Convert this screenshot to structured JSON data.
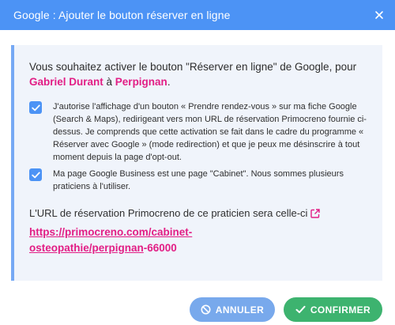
{
  "dialog": {
    "title": "Google : Ajouter le bouton réserver en ligne",
    "close_icon": "close-icon"
  },
  "intro": {
    "line1": "Vous souhaitez activer le bouton \"Réserver en ligne\" de Google, pour",
    "practitioner": "Gabriel Durant",
    "a_word": " à ",
    "city": "Perpignan",
    "end": "."
  },
  "checkboxes": [
    {
      "checked": true,
      "text": "J'autorise l'affichage d'un bouton « Prendre rendez-vous » sur ma fiche Google (Search & Maps), redirigeant vers mon URL de réservation Primocreno fournie ci-dessus. Je comprends que cette activation se fait dans le cadre du programme « Réserver avec Google » (mode redirection) et que je peux me désinscrire à tout moment depuis la page d'opt-out."
    },
    {
      "checked": true,
      "text": "Ma page Google Business est une page \"Cabinet\". Nous sommes plusieurs praticiens à l'utiliser."
    }
  ],
  "url_section": {
    "label": "L'URL de réservation Primocreno de ce praticien sera celle-ci",
    "link_text": "https://primocreno.com/cabinet-osteopathie/perpignan",
    "suffix": "-66000"
  },
  "buttons": {
    "cancel": "ANNULER",
    "confirm": "CONFIRMER"
  },
  "colors": {
    "header": "#4c93f5",
    "accent_pink": "#e21e85",
    "confirm_green": "#3db36f",
    "cancel_blue": "#78a9ec",
    "panel_bg": "#f0f4fb"
  }
}
